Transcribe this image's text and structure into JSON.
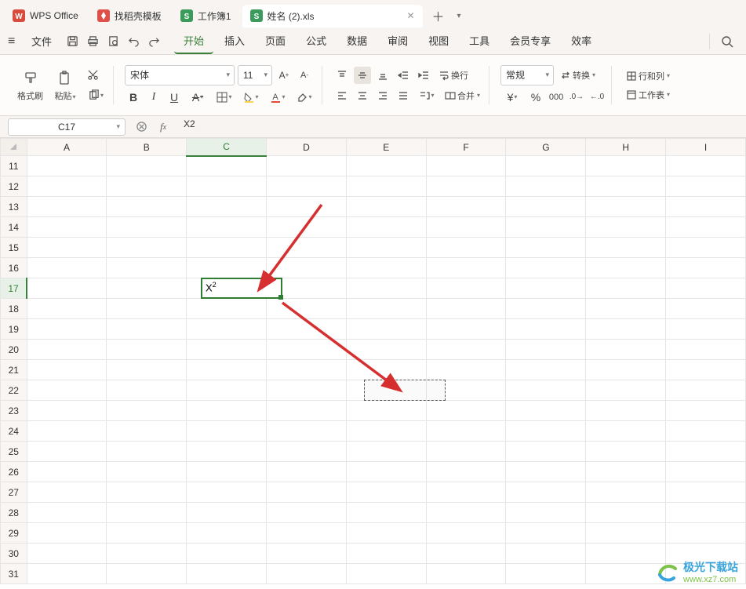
{
  "tabs": {
    "app": {
      "label": "WPS Office"
    },
    "tpl": {
      "label": "找稻壳模板"
    },
    "wb1": {
      "label": "工作簿1"
    },
    "wb2": {
      "label": "姓名 (2).xls"
    }
  },
  "menu": {
    "file": "文件",
    "items": {
      "start": "开始",
      "insert": "插入",
      "page": "页面",
      "formula": "公式",
      "data": "数据",
      "review": "审阅",
      "view": "视图",
      "tools": "工具",
      "member": "会员专享",
      "efficiency": "效率"
    }
  },
  "ribbon": {
    "format_painter": "格式刷",
    "paste": "粘贴",
    "font_name": "宋体",
    "font_size": "11",
    "wrap": "换行",
    "merge": "合并",
    "number_format": "常规",
    "convert": "转换",
    "rows_cols": "行和列",
    "worksheet": "工作表"
  },
  "formula_bar": {
    "name_box": "C17",
    "fx_value": "X2"
  },
  "grid": {
    "cols": [
      "A",
      "B",
      "C",
      "D",
      "E",
      "F",
      "G",
      "H",
      "I"
    ],
    "rows": [
      "11",
      "12",
      "13",
      "14",
      "15",
      "16",
      "17",
      "18",
      "19",
      "20",
      "21",
      "22",
      "23",
      "24",
      "25",
      "26",
      "27",
      "28",
      "29",
      "30",
      "31"
    ],
    "active_cell_ref": "C17",
    "active_cell_display_base": "X",
    "active_cell_display_sup": "2",
    "marquee_ref": "E22"
  },
  "watermark": {
    "name": "极光下载站",
    "url": "www.xz7.com"
  }
}
